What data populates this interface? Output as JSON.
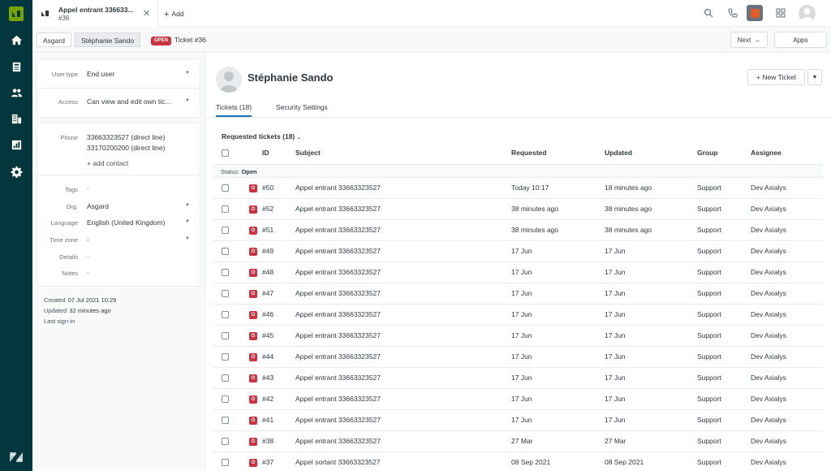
{
  "nav": {
    "items": [
      {
        "name": "home-icon"
      },
      {
        "name": "views-icon"
      },
      {
        "name": "customers-icon"
      },
      {
        "name": "organizations-icon"
      },
      {
        "name": "reporting-icon"
      },
      {
        "name": "admin-gear-icon"
      }
    ]
  },
  "topbar": {
    "tab_title": "Appel entrant 336633...",
    "tab_sub": "#36",
    "add_label": "Add"
  },
  "crumbs": {
    "org": "Asgard",
    "user": "Stéphanie Sando",
    "ticket_badge": "OPEN",
    "ticket": "Ticket #36",
    "next": "Next",
    "apps": "Apps"
  },
  "user_fields": {
    "user_type_label": "User type",
    "user_type_value": "End user",
    "access_label": "Access",
    "access_value": "Can view and edit own tic...",
    "phone_label": "Phone",
    "phone_1": "33663323527 (direct line)",
    "phone_2": "33170200200 (direct line)",
    "add_contact": "+ add contact",
    "tags_label": "Tags",
    "tags_value": "-",
    "org_label": "Org.",
    "org_value": "Asgard",
    "language_label": "Language",
    "language_value": "English (United Kingdom)",
    "timezone_label": "Time zone",
    "timezone_value": "-",
    "details_label": "Details",
    "details_value": "-",
    "notes_label": "Notes",
    "notes_value": "-"
  },
  "meta": {
    "created_label": "Created",
    "created_value": "07 Jul 2021 10:29",
    "updated_label": "Updated",
    "updated_value": "32 minutes ago",
    "last_signin_label": "Last sign-in"
  },
  "profile": {
    "name": "Stéphanie Sando",
    "new_ticket": "+ New Ticket",
    "tab_tickets": "Tickets (18)",
    "tab_security": "Security Settings",
    "requested_title": "Requested tickets (18)"
  },
  "table": {
    "headers": {
      "id": "ID",
      "subject": "Subject",
      "requested": "Requested",
      "updated": "Updated",
      "group": "Group",
      "assignee": "Assignee"
    },
    "status_label": "Status:",
    "status_value": "Open",
    "badge": "O",
    "rows": [
      {
        "id": "#50",
        "subject": "Appel entrant 33663323527",
        "requested": "Today 10:17",
        "updated": "18 minutes ago",
        "group": "Support",
        "assignee": "Dev Axialys"
      },
      {
        "id": "#52",
        "subject": "Appel entrant 33663323527",
        "requested": "38 minutes ago",
        "updated": "38 minutes ago",
        "group": "Support",
        "assignee": "Dev Axialys"
      },
      {
        "id": "#51",
        "subject": "Appel entrant 33663323527",
        "requested": "38 minutes ago",
        "updated": "38 minutes ago",
        "group": "Support",
        "assignee": "Dev Axialys"
      },
      {
        "id": "#49",
        "subject": "Appel entrant 33663323527",
        "requested": "17 Jun",
        "updated": "17 Jun",
        "group": "Support",
        "assignee": "Dev Axialys"
      },
      {
        "id": "#48",
        "subject": "Appel entrant 33663323527",
        "requested": "17 Jun",
        "updated": "17 Jun",
        "group": "Support",
        "assignee": "Dev Axialys"
      },
      {
        "id": "#47",
        "subject": "Appel entrant 33663323527",
        "requested": "17 Jun",
        "updated": "17 Jun",
        "group": "Support",
        "assignee": "Dev Axialys"
      },
      {
        "id": "#46",
        "subject": "Appel entrant 33663323527",
        "requested": "17 Jun",
        "updated": "17 Jun",
        "group": "Support",
        "assignee": "Dev Axialys"
      },
      {
        "id": "#45",
        "subject": "Appel entrant 33663323527",
        "requested": "17 Jun",
        "updated": "17 Jun",
        "group": "Support",
        "assignee": "Dev Axialys"
      },
      {
        "id": "#44",
        "subject": "Appel entrant 33663323527",
        "requested": "17 Jun",
        "updated": "17 Jun",
        "group": "Support",
        "assignee": "Dev Axialys"
      },
      {
        "id": "#43",
        "subject": "Appel entrant 33663323527",
        "requested": "17 Jun",
        "updated": "17 Jun",
        "group": "Support",
        "assignee": "Dev Axialys"
      },
      {
        "id": "#42",
        "subject": "Appel entrant 33663323527",
        "requested": "17 Jun",
        "updated": "17 Jun",
        "group": "Support",
        "assignee": "Dev Axialys"
      },
      {
        "id": "#41",
        "subject": "Appel entrant 33663323527",
        "requested": "17 Jun",
        "updated": "17 Jun",
        "group": "Support",
        "assignee": "Dev Axialys"
      },
      {
        "id": "#38",
        "subject": "Appel entrant 33663323527",
        "requested": "27 Mar",
        "updated": "27 Mar",
        "group": "Support",
        "assignee": "Dev Axialys"
      },
      {
        "id": "#37",
        "subject": "Appel sortant 33663323527",
        "requested": "08 Sep 2021",
        "updated": "08 Sep 2021",
        "group": "Support",
        "assignee": "Dev Axialys"
      }
    ]
  },
  "colors": {
    "nav_bg": "#03363d",
    "logo_green": "#78a300",
    "badge_red": "#cc3340",
    "active_tab": "#1f73b7"
  }
}
